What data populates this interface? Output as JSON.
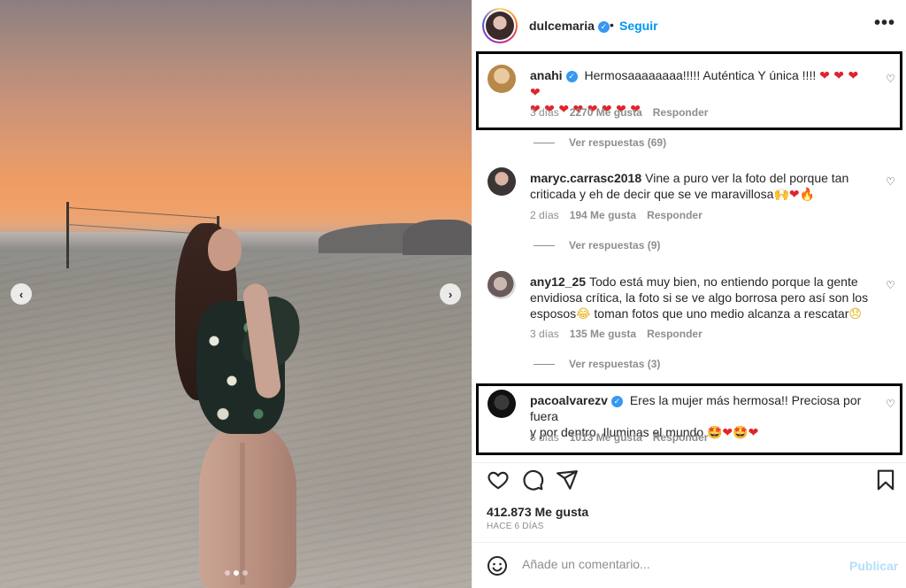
{
  "post": {
    "author": "dulcemaria",
    "follow_label": "Seguir",
    "header_separator": "•",
    "more_label": "•••",
    "carousel": {
      "prev_label": "‹",
      "next_label": "›",
      "slides": 3,
      "active_slide": 2
    }
  },
  "comments": [
    {
      "user": "anahi",
      "verified": true,
      "text": "Hermosaaaaaaaa!!!!! Auténtica Y única !!!!",
      "emojis_line1": "❤ ❤ ❤ ❤",
      "emojis_line2": "❤ ❤ ❤ ❤ ❤ ❤ ❤ ❤",
      "time": "3 días",
      "likes": "2270 Me gusta",
      "reply_label": "Responder",
      "replies_label": "Ver respuestas (69)",
      "highlighted": true
    },
    {
      "user": "maryc.carrasc2018",
      "verified": false,
      "text_line1": "Vine a puro ver la foto del porque tan",
      "text_line2": "criticada y eh de decir que se ve maravillosa",
      "emojis": "🙌❤🔥",
      "time": "2 días",
      "likes": "194 Me gusta",
      "reply_label": "Responder",
      "replies_label": "Ver respuestas (9)"
    },
    {
      "user": "any12_25",
      "verified": false,
      "text_line1": "Todo está muy bien, no entiendo porque la gente",
      "text_line2": "envidiosa crítica, la foto si se ve algo borrosa pero así son los",
      "text_line3a": "esposos",
      "emoji_laugh": "😂",
      "text_line3b": "toman fotos que uno medio alcanza a rescatar",
      "emoji_sad": "😞",
      "time": "3 días",
      "likes": "135 Me gusta",
      "reply_label": "Responder",
      "replies_label": "Ver respuestas (3)"
    },
    {
      "user": "pacoalvarezv",
      "verified": true,
      "text_line1": "Eres la mujer más hermosa!! Preciosa por fuera",
      "text_line2": "y por dentro. Iluminas el mundo.",
      "emojis": "🤩❤🤩❤",
      "time": "5 días",
      "likes": "1013 Me gusta",
      "reply_label": "Responder",
      "highlighted": true
    }
  ],
  "footer": {
    "likes_total": "412.873 Me gusta",
    "time_ago": "HACE 6 DÍAS",
    "comment_placeholder": "Añade un comentario...",
    "publish_label": "Publicar"
  },
  "icons": {
    "heart": "heart-icon",
    "comment": "comment-icon",
    "share": "share-icon",
    "save": "bookmark-icon",
    "emoji": "smile-icon",
    "verified": "verified-icon"
  },
  "colors": {
    "link": "#0095f6",
    "verified": "#3897f0",
    "muted": "#8e8e8e",
    "publish_disabled": "#b2dffc"
  }
}
